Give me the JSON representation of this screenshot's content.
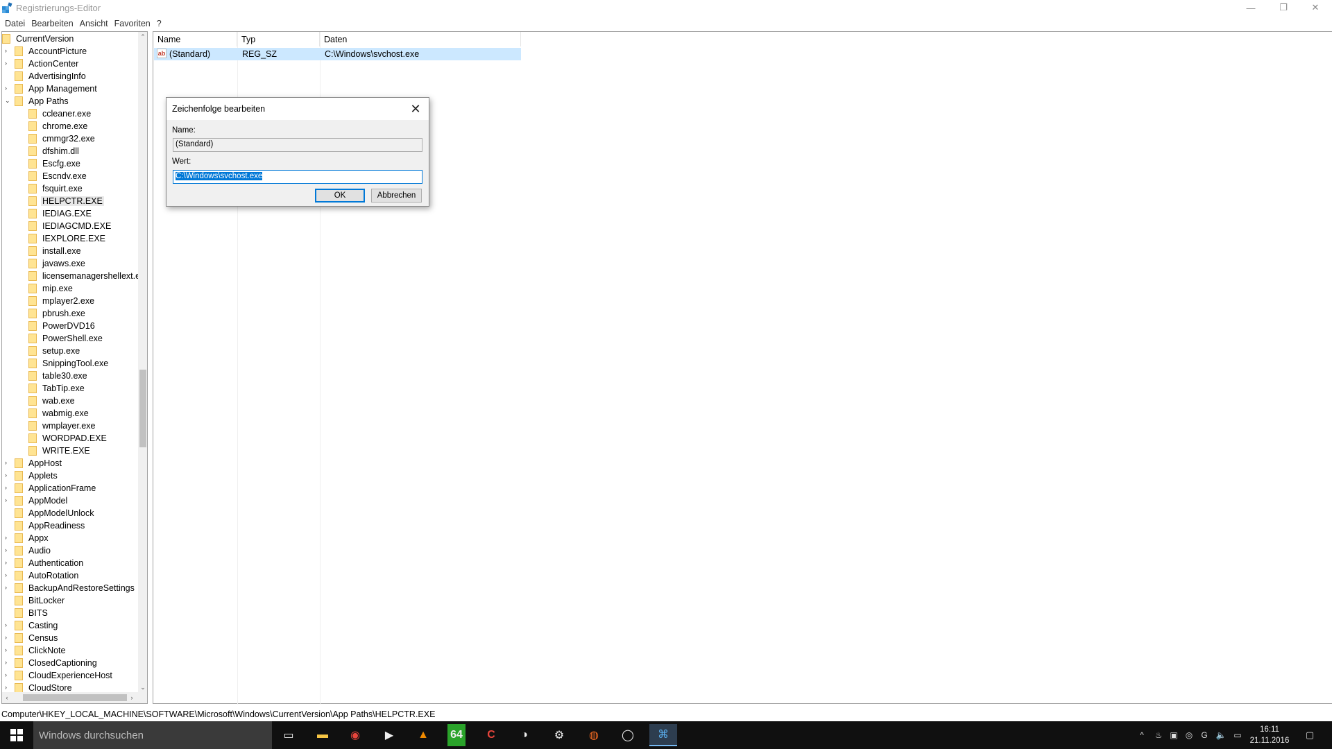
{
  "window": {
    "title": "Registrierungs-Editor",
    "controls": {
      "minimize": "—",
      "maximize": "❐",
      "close": "✕"
    }
  },
  "menu": [
    "Datei",
    "Bearbeiten",
    "Ansicht",
    "Favoriten",
    "?"
  ],
  "tree": {
    "root": "CurrentVersion",
    "items": [
      {
        "label": "AccountPicture",
        "depth": 1,
        "expander": "›"
      },
      {
        "label": "ActionCenter",
        "depth": 1,
        "expander": "›"
      },
      {
        "label": "AdvertisingInfo",
        "depth": 1,
        "expander": ""
      },
      {
        "label": "App Management",
        "depth": 1,
        "expander": "›"
      },
      {
        "label": "App Paths",
        "depth": 1,
        "expander": "⌄"
      },
      {
        "label": "ccleaner.exe",
        "depth": 2,
        "expander": ""
      },
      {
        "label": "chrome.exe",
        "depth": 2,
        "expander": ""
      },
      {
        "label": "cmmgr32.exe",
        "depth": 2,
        "expander": ""
      },
      {
        "label": "dfshim.dll",
        "depth": 2,
        "expander": ""
      },
      {
        "label": "Escfg.exe",
        "depth": 2,
        "expander": ""
      },
      {
        "label": "Escndv.exe",
        "depth": 2,
        "expander": ""
      },
      {
        "label": "fsquirt.exe",
        "depth": 2,
        "expander": ""
      },
      {
        "label": "HELPCTR.EXE",
        "depth": 2,
        "expander": "",
        "selected": true
      },
      {
        "label": "IEDIAG.EXE",
        "depth": 2,
        "expander": ""
      },
      {
        "label": "IEDIAGCMD.EXE",
        "depth": 2,
        "expander": ""
      },
      {
        "label": "IEXPLORE.EXE",
        "depth": 2,
        "expander": ""
      },
      {
        "label": "install.exe",
        "depth": 2,
        "expander": ""
      },
      {
        "label": "javaws.exe",
        "depth": 2,
        "expander": ""
      },
      {
        "label": "licensemanagershellext.exe",
        "depth": 2,
        "expander": ""
      },
      {
        "label": "mip.exe",
        "depth": 2,
        "expander": ""
      },
      {
        "label": "mplayer2.exe",
        "depth": 2,
        "expander": ""
      },
      {
        "label": "pbrush.exe",
        "depth": 2,
        "expander": ""
      },
      {
        "label": "PowerDVD16",
        "depth": 2,
        "expander": ""
      },
      {
        "label": "PowerShell.exe",
        "depth": 2,
        "expander": ""
      },
      {
        "label": "setup.exe",
        "depth": 2,
        "expander": ""
      },
      {
        "label": "SnippingTool.exe",
        "depth": 2,
        "expander": ""
      },
      {
        "label": "table30.exe",
        "depth": 2,
        "expander": ""
      },
      {
        "label": "TabTip.exe",
        "depth": 2,
        "expander": ""
      },
      {
        "label": "wab.exe",
        "depth": 2,
        "expander": ""
      },
      {
        "label": "wabmig.exe",
        "depth": 2,
        "expander": ""
      },
      {
        "label": "wmplayer.exe",
        "depth": 2,
        "expander": ""
      },
      {
        "label": "WORDPAD.EXE",
        "depth": 2,
        "expander": ""
      },
      {
        "label": "WRITE.EXE",
        "depth": 2,
        "expander": ""
      },
      {
        "label": "AppHost",
        "depth": 1,
        "expander": "›"
      },
      {
        "label": "Applets",
        "depth": 1,
        "expander": "›"
      },
      {
        "label": "ApplicationFrame",
        "depth": 1,
        "expander": "›"
      },
      {
        "label": "AppModel",
        "depth": 1,
        "expander": "›"
      },
      {
        "label": "AppModelUnlock",
        "depth": 1,
        "expander": ""
      },
      {
        "label": "AppReadiness",
        "depth": 1,
        "expander": ""
      },
      {
        "label": "Appx",
        "depth": 1,
        "expander": "›"
      },
      {
        "label": "Audio",
        "depth": 1,
        "expander": "›"
      },
      {
        "label": "Authentication",
        "depth": 1,
        "expander": "›"
      },
      {
        "label": "AutoRotation",
        "depth": 1,
        "expander": "›"
      },
      {
        "label": "BackupAndRestoreSettings",
        "depth": 1,
        "expander": "›"
      },
      {
        "label": "BitLocker",
        "depth": 1,
        "expander": ""
      },
      {
        "label": "BITS",
        "depth": 1,
        "expander": ""
      },
      {
        "label": "Casting",
        "depth": 1,
        "expander": "›"
      },
      {
        "label": "Census",
        "depth": 1,
        "expander": "›"
      },
      {
        "label": "ClickNote",
        "depth": 1,
        "expander": "›"
      },
      {
        "label": "ClosedCaptioning",
        "depth": 1,
        "expander": "›"
      },
      {
        "label": "CloudExperienceHost",
        "depth": 1,
        "expander": "›"
      },
      {
        "label": "CloudStore",
        "depth": 1,
        "expander": "›"
      }
    ]
  },
  "list": {
    "columns": [
      "Name",
      "Typ",
      "Daten"
    ],
    "rows": [
      {
        "icon": "ab",
        "name": "(Standard)",
        "type": "REG_SZ",
        "data": "C:\\Windows\\svchost.exe"
      }
    ]
  },
  "status_path": "Computer\\HKEY_LOCAL_MACHINE\\SOFTWARE\\Microsoft\\Windows\\CurrentVersion\\App Paths\\HELPCTR.EXE",
  "dialog": {
    "title": "Zeichenfolge bearbeiten",
    "name_label": "Name:",
    "name_value": "(Standard)",
    "value_label": "Wert:",
    "value_value": "C:\\Windows\\svchost.exe",
    "ok_label": "OK",
    "cancel_label": "Abbrechen"
  },
  "taskbar": {
    "search_placeholder": "Windows durchsuchen",
    "apps": [
      {
        "name": "task-view-icon",
        "glyph": "▭"
      },
      {
        "name": "file-explorer-icon",
        "glyph": "▬"
      },
      {
        "name": "chrome-icon",
        "glyph": "◉"
      },
      {
        "name": "media-player-icon",
        "glyph": "▶"
      },
      {
        "name": "vlc-icon",
        "glyph": "▲"
      },
      {
        "name": "sixtyfour-icon",
        "glyph": "64"
      },
      {
        "name": "ccleaner-icon",
        "glyph": "C"
      },
      {
        "name": "game-icon",
        "glyph": "◑"
      },
      {
        "name": "steam-icon",
        "glyph": "⚙"
      },
      {
        "name": "origin-icon",
        "glyph": "◍"
      },
      {
        "name": "app-ring-icon",
        "glyph": "◯"
      },
      {
        "name": "regedit-icon",
        "glyph": "⌘"
      }
    ],
    "tray": [
      "^",
      "♨",
      "▣",
      "◎",
      "G",
      "🔈",
      "▭"
    ],
    "time": "16:11",
    "date": "21.11.2016"
  }
}
